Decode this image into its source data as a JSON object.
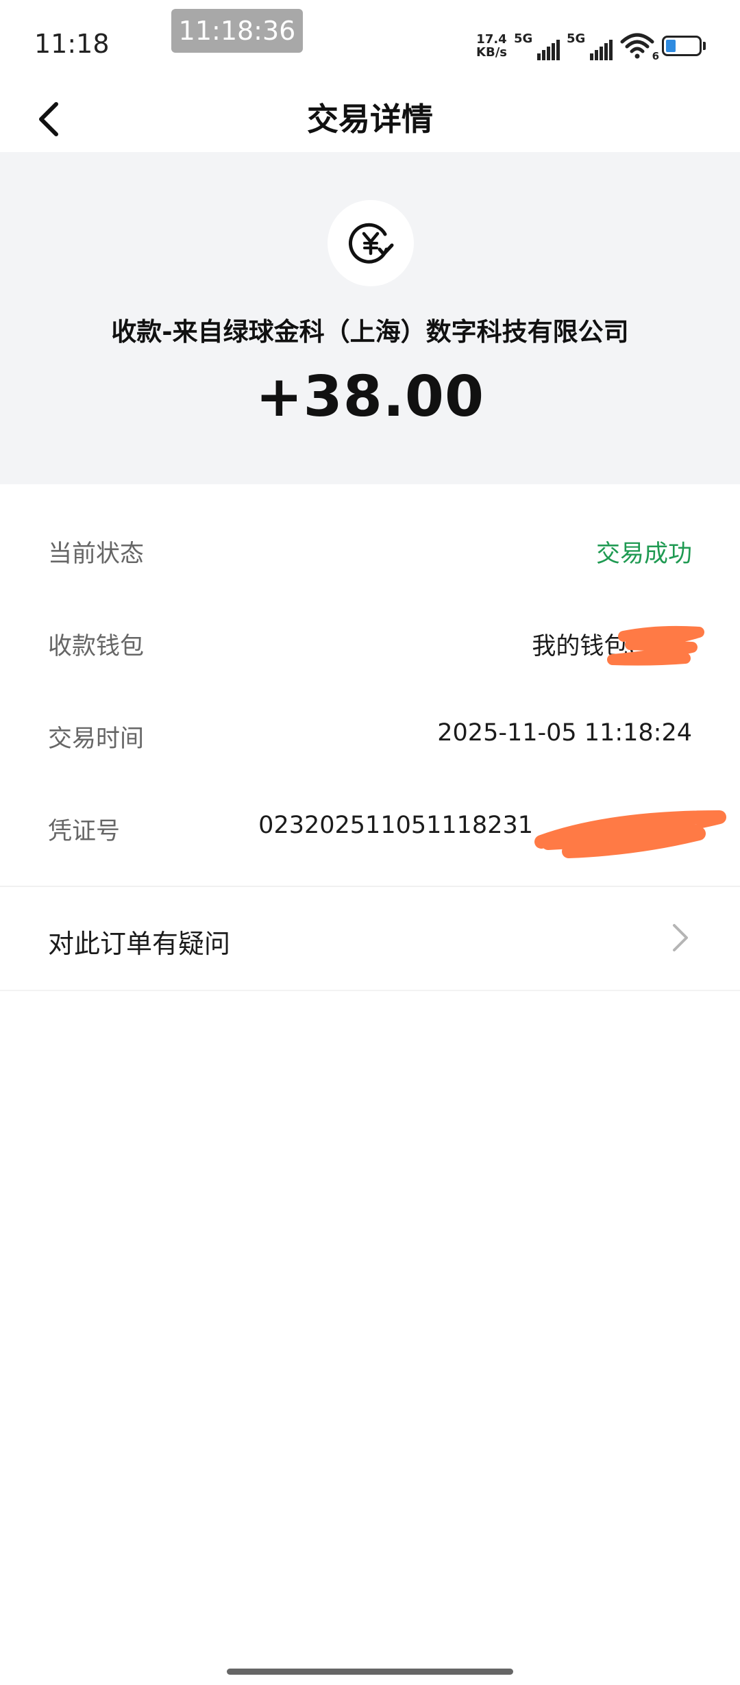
{
  "status_bar": {
    "time": "11:18",
    "screenshot_time": "11:18:36",
    "net_speed_value": "17.4",
    "net_speed_unit": "KB/s",
    "sim1_label": "5G",
    "sim2_label": "5G",
    "wifi_badge": "6"
  },
  "nav": {
    "title": "交易详情"
  },
  "summary": {
    "payer": "收款-来自绿球金科（上海）数字科技有限公司",
    "amount": "+38.00",
    "icon": "yuan-received-icon"
  },
  "details": [
    {
      "label": "当前状态",
      "value": "交易成功",
      "status": "success"
    },
    {
      "label": "收款钱包",
      "value": "我的钱包("
    },
    {
      "label": "交易时间",
      "value": "2025-11-05 11:18:24"
    },
    {
      "label": "凭证号",
      "value": "023202511051118231"
    }
  ],
  "question": {
    "label": "对此订单有疑问"
  },
  "colors": {
    "success": "#1f9a52",
    "header_bg": "#f3f4f6",
    "redaction": "#ff7a45"
  }
}
